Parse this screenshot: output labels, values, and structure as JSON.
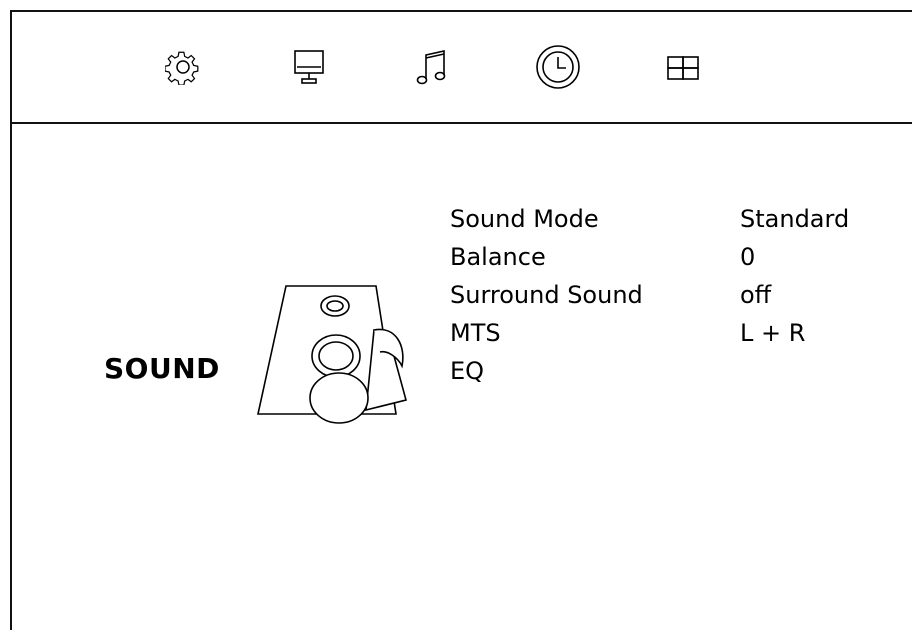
{
  "tabs": [
    {
      "icon": "gear-icon",
      "name": "tab-setup"
    },
    {
      "icon": "monitor-icon",
      "name": "tab-picture"
    },
    {
      "icon": "music-note-icon",
      "name": "tab-sound"
    },
    {
      "icon": "clock-icon",
      "name": "tab-time"
    },
    {
      "icon": "grid-icon",
      "name": "tab-options"
    }
  ],
  "section": {
    "title": "SOUND",
    "icon": "speaker-music-icon"
  },
  "menu": {
    "items": [
      {
        "label": "Sound Mode",
        "value": "Standard"
      },
      {
        "label": "Balance",
        "value": "0"
      },
      {
        "label": "Surround Sound",
        "value": "off"
      },
      {
        "label": "MTS",
        "value": "L + R"
      },
      {
        "label": "EQ",
        "value": ""
      }
    ]
  },
  "colors": {
    "foreground": "#000000",
    "background": "#ffffff"
  }
}
